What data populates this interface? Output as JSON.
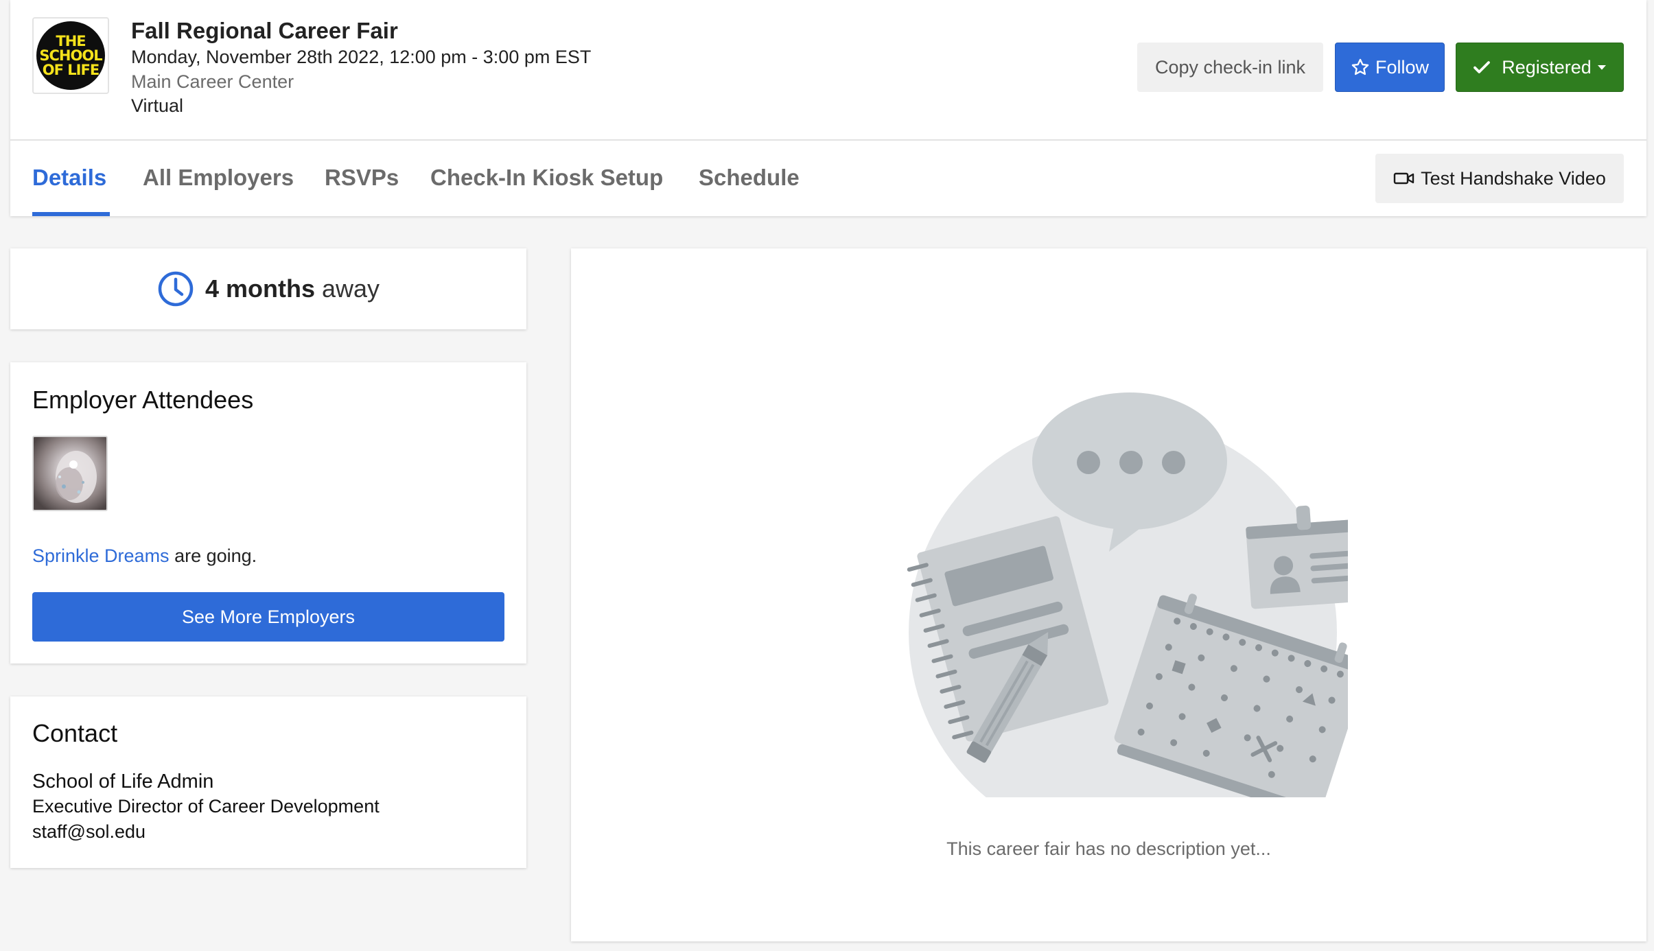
{
  "event": {
    "logo_text": [
      "THE",
      "SCHOOL",
      "OF LIFE"
    ],
    "title": "Fall Regional Career Fair",
    "datetime": "Monday, November 28th 2022, 12:00 pm - 3:00 pm EST",
    "location": "Main Career Center",
    "format": "Virtual"
  },
  "actions": {
    "copy_link": "Copy check-in link",
    "follow": "Follow",
    "registered": "Registered"
  },
  "tabs": [
    {
      "label": "Details",
      "active": true
    },
    {
      "label": "All Employers",
      "active": false
    },
    {
      "label": "RSVPs",
      "active": false
    },
    {
      "label": "Check-In Kiosk Setup",
      "active": false
    },
    {
      "label": "Schedule",
      "active": false
    }
  ],
  "video_button": "Test Handshake Video",
  "countdown": {
    "amount": "4 months",
    "suffix": "away"
  },
  "employers": {
    "title": "Employer Attendees",
    "attendee_name": "Sprinkle Dreams",
    "going_text": "are going.",
    "more_button": "See More Employers"
  },
  "contact": {
    "title": "Contact",
    "name": "School of Life Admin",
    "role": "Executive Director of Career Development",
    "email": "staff@sol.edu"
  },
  "description": {
    "empty_text": "This career fair has no description yet..."
  },
  "colors": {
    "primary": "#2e6bd8",
    "success": "#2f7d1f",
    "muted": "#6b6b6b"
  }
}
